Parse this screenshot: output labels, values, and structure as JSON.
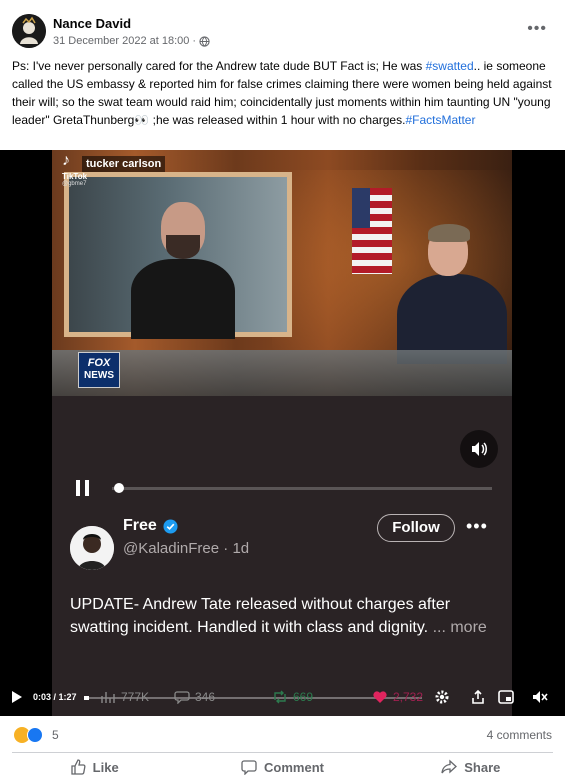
{
  "post": {
    "author": "Nance David",
    "timestamp": "31 December 2022 at 18:00",
    "separator": "·",
    "privacy_icon": "globe-icon",
    "text_before_tag1": "Ps: I've never personally cared for the Andrew tate dude BUT Fact is; He was ",
    "hashtag1": "#swatted",
    "text_middle": ".. ie someone called the US embassy & reported him for false crimes claiming there were women being held against their will; so the swat team would raid him; coincidentally just moments within him taunting UN \"young leader\" GretaThunberg",
    "emoji": "👀",
    "text_after_emoji": " ;he was released within 1 hour with no charges.",
    "hashtag2": "#FactsMatter"
  },
  "video": {
    "tiktok_show_label": "tucker carlson",
    "tiktok_wordmark": "TikTok",
    "tiktok_handle": "@gbme7",
    "channel_logo_line1": "FOX",
    "channel_logo_line2": "NEWS",
    "tweet": {
      "name": "Free",
      "handle": "@KaladinFree · 1d",
      "follow_label": "Follow",
      "more_label": "•••",
      "text": "UPDATE- Andrew Tate released without charges after swatting incident. Handled it with class and dignity.",
      "more_link": " ... more"
    },
    "controls": {
      "time": "0:03 / 1:27",
      "views": "777K",
      "comments": "346",
      "retweets": "669",
      "likes": "2,732"
    }
  },
  "engagement": {
    "reaction_count": "5",
    "comment_count": "4 comments"
  },
  "actions": {
    "like": "Like",
    "comment": "Comment",
    "share": "Share"
  },
  "colors": {
    "hashtag": "#216fdb",
    "like_blue": "#1877f2",
    "video_bg": "#2a2325"
  }
}
